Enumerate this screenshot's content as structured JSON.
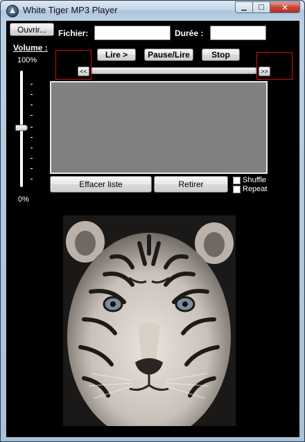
{
  "window": {
    "title": "White Tiger MP3 Player",
    "minimize_icon": "minimize-icon",
    "maximize_icon": "maximize-icon",
    "close_icon": "close-icon",
    "minimize_glyph": "▁",
    "maximize_glyph": "□",
    "close_glyph": "✕"
  },
  "toolbar": {
    "open_label": "Ouvrir...",
    "file_label": "Fichier:",
    "file_value": "",
    "duration_label": "Durée :",
    "duration_value": ""
  },
  "transport": {
    "play_label": "Lire  >",
    "pause_label": "Pause/Lire",
    "stop_label": "Stop",
    "prev_label": "<<",
    "next_label": ">>",
    "seek_position": 0
  },
  "volume": {
    "label": "Volume :",
    "max_label": "100%",
    "min_label": "0%",
    "level_percent": 50
  },
  "playlist": {
    "items": [],
    "clear_label": "Effacer liste",
    "remove_label": "Retirer",
    "shuffle_label": "Shuffle",
    "repeat_label": "Repeat",
    "shuffle_checked": false,
    "repeat_checked": false
  },
  "colors": {
    "background": "#000000",
    "accent_red": "#d21010",
    "playlist_bg": "#808080"
  }
}
